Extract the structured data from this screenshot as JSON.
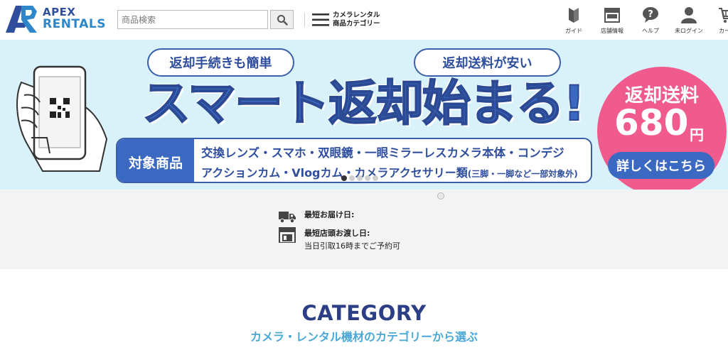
{
  "header": {
    "logo_line1": "APEX",
    "logo_line2": "RENTALS",
    "search_placeholder": "商品検索",
    "category_menu_line1": "カメラレンタル",
    "category_menu_line2": "商品カテゴリー",
    "nav": [
      {
        "label": "ガイド",
        "icon": "guide-book-icon"
      },
      {
        "label": "店舗情報",
        "icon": "store-icon"
      },
      {
        "label": "ヘルプ",
        "icon": "help-bubble-icon"
      },
      {
        "label": "未ログイン",
        "icon": "user-icon"
      },
      {
        "label": "カート",
        "icon": "cart-icon"
      }
    ]
  },
  "banner": {
    "badge_left": "返却手続きも簡単",
    "badge_right": "返却送料が安い",
    "headline": "スマート返却始まる!",
    "target_label": "対象商品",
    "target_line1": "交換レンズ・スマホ・双眼鏡・一眼ミラーレスカメラ本体・コンデジ",
    "target_line2": "アクションカム・Vlogカム・カメラアクセサリー類",
    "target_line2_note": "(三脚・一脚など一部対象外)",
    "price_label": "返却送料",
    "price_amount": "680",
    "price_unit": "円",
    "detail_button": "詳しくはこちら",
    "slide_count": 5,
    "active_slide": 1
  },
  "info": {
    "delivery_label": "最短お届け日:",
    "pickup_label": "最短店頭お渡し日:",
    "pickup_value": "当日引取16時までご予約可"
  },
  "category": {
    "title": "CATEGORY",
    "subtitle": "カメラ・レンタル機材のカテゴリーから選ぶ"
  },
  "colors": {
    "brand_navy": "#2f4f9e",
    "brand_blue": "#3b68c1",
    "banner_bg": "#d9f1f8",
    "price_pink": "#f05a8d",
    "subtitle_blue": "#4aa8d8"
  }
}
